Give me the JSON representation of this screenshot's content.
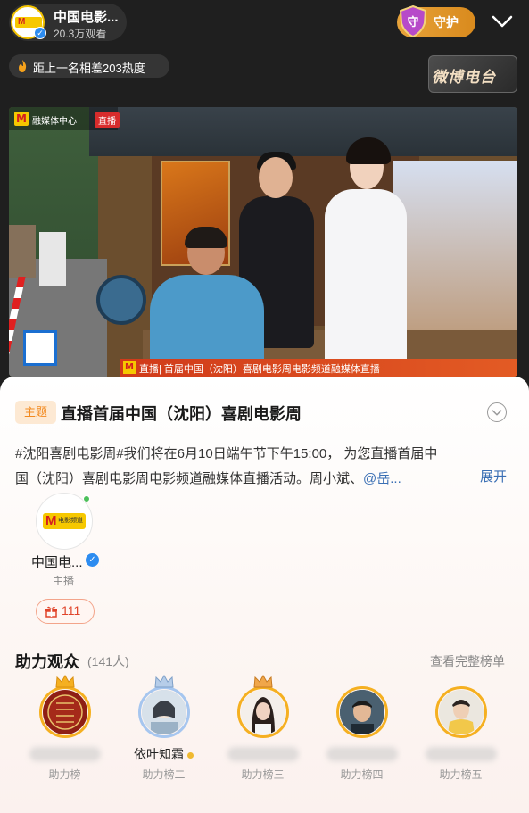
{
  "header": {
    "host_name": "中国电影...",
    "viewers": "20.3万观看",
    "guard_label": "守护",
    "guard_badge": "守",
    "rank_text": "距上一名相差203热度",
    "radio_label": "微博电台"
  },
  "video": {
    "live_org": "融媒体中心",
    "live_badge": "直播",
    "caption": "| 首届中国（沈阳）喜剧电影周电影频道融媒体直播",
    "caption_prefix": "直播"
  },
  "card": {
    "topic_tag": "主题",
    "topic_title": "直播首届中国（沈阳）喜剧电影周",
    "desc_line1": "#沈阳喜剧电影周#我们将在6月10日端午节下午15:00， 为您直播首届中",
    "desc_line2_text": "国（沈阳）喜剧电影周电影频道融媒体直播活动。周小斌、",
    "desc_line2_mention": "@岳...",
    "expand_label": "展开",
    "anchor": {
      "name": "中国电...",
      "role": "主播",
      "gift_count": "111",
      "logo_letter": "M",
      "logo_text": "电影频道"
    },
    "fans": {
      "title": "助力观众",
      "count": "(141人)",
      "more": "查看完整榜单",
      "list": [
        {
          "name": "",
          "rank": "助力榜",
          "blurred": true,
          "ring": "gold",
          "crown": "gold"
        },
        {
          "name": "依叶知霜",
          "rank": "助力榜二",
          "blurred": false,
          "ring": "silver",
          "crown": "silver"
        },
        {
          "name": "",
          "rank": "助力榜三",
          "blurred": true,
          "ring": "gold",
          "crown": "bronze"
        },
        {
          "name": "",
          "rank": "助力榜四",
          "blurred": true,
          "ring": "gold",
          "crown": ""
        },
        {
          "name": "",
          "rank": "助力榜五",
          "blurred": true,
          "ring": "gold",
          "crown": ""
        }
      ]
    }
  },
  "colors": {
    "accent_orange": "#f28a20",
    "link_blue": "#3a6fb4",
    "gift_red": "#e0442a",
    "gold_ring": "#f5b021",
    "verify_blue": "#2d8cf0"
  }
}
